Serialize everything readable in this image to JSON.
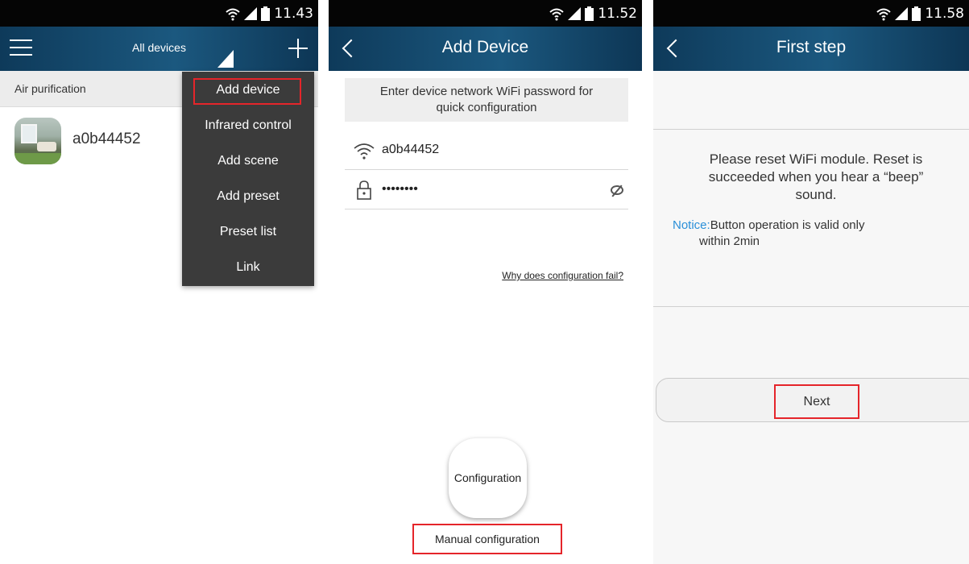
{
  "screens": [
    {
      "status": {
        "time": "11.43"
      },
      "header": {
        "title": "All devices"
      },
      "section": {
        "title": "Air purification"
      },
      "devices": [
        {
          "name": "a0b44452"
        }
      ],
      "dropdown": {
        "items": [
          {
            "label": "Add device"
          },
          {
            "label": "Infrared control"
          },
          {
            "label": "Add scene"
          },
          {
            "label": "Add preset"
          },
          {
            "label": "Preset list"
          },
          {
            "label": "Link"
          }
        ]
      }
    },
    {
      "status": {
        "time": "11.52"
      },
      "header": {
        "title": "Add Device"
      },
      "info": {
        "line1": "Enter device network WiFi password for",
        "line2": "quick configuration"
      },
      "wifi": {
        "ssid": "a0b44452",
        "password_mask": "••••••••"
      },
      "link": "Why does configuration fail?",
      "config_button": "Configuration",
      "manual_button": "Manual configuration"
    },
    {
      "status": {
        "time": "11.58"
      },
      "header": {
        "title": "First step"
      },
      "reset": {
        "line1": "Please reset WiFi module. Reset is",
        "line2": "succeeded when you hear a “beep”",
        "line3": "sound."
      },
      "notice": {
        "label": "Notice:",
        "line1": "Button operation is valid only",
        "line2": "within 2min"
      },
      "next_button": "Next"
    }
  ],
  "colors": {
    "highlight": "#e5252a",
    "appbar": "#1b587f",
    "notice": "#2a8fd8"
  }
}
